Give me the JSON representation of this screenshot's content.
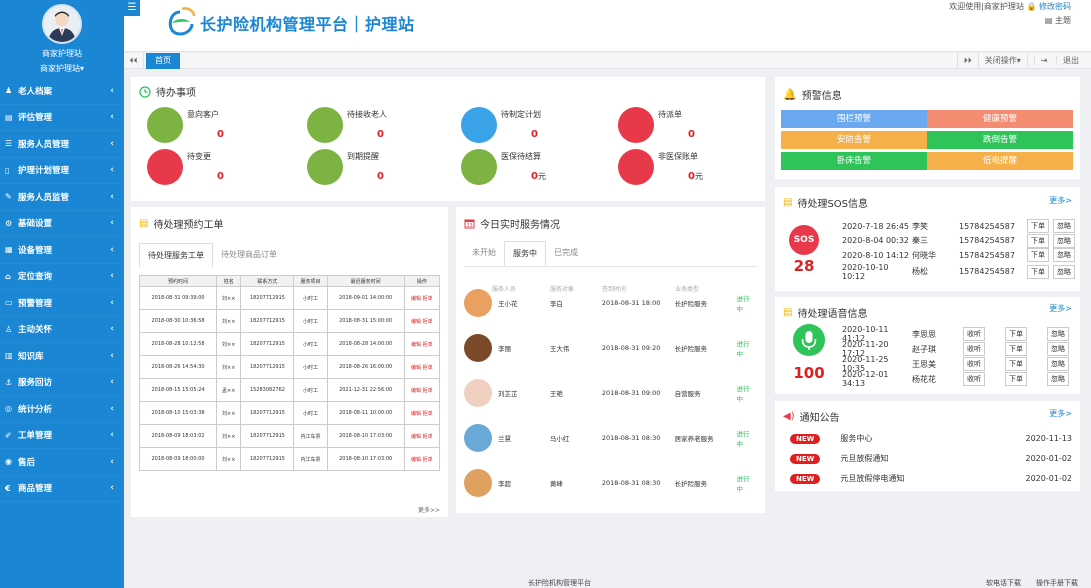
{
  "sidebar": {
    "user_name": "商家护理站",
    "user_menu": "商家护理站",
    "items": [
      {
        "icon": "user-icon",
        "glyph": "♟",
        "label": "老人档案"
      },
      {
        "icon": "file-icon",
        "glyph": "▤",
        "label": "评估管理"
      },
      {
        "icon": "list-icon",
        "glyph": "☰",
        "label": "服务人员管理"
      },
      {
        "icon": "doc-icon",
        "glyph": "▯",
        "label": "护理计划管理"
      },
      {
        "icon": "pen-icon",
        "glyph": "✎",
        "label": "服务人员监管"
      },
      {
        "icon": "gear-icon",
        "glyph": "⚙",
        "label": "基础设置"
      },
      {
        "icon": "table-icon",
        "glyph": "▦",
        "label": "设备管理"
      },
      {
        "icon": "bank-icon",
        "glyph": "⌂",
        "label": "定位查询"
      },
      {
        "icon": "monitor-icon",
        "glyph": "▭",
        "label": "预警管理"
      },
      {
        "icon": "person-icon",
        "glyph": "♙",
        "label": "主动关怀"
      },
      {
        "icon": "grid-icon",
        "glyph": "▥",
        "label": "知识库"
      },
      {
        "icon": "anchor-icon",
        "glyph": "⚓",
        "label": "服务回访"
      },
      {
        "icon": "chart-icon",
        "glyph": "◎",
        "label": "统计分析"
      },
      {
        "icon": "wrench-icon",
        "glyph": "✐",
        "label": "工单管理"
      },
      {
        "icon": "circle-icon",
        "glyph": "◉",
        "label": "售后"
      },
      {
        "icon": "euro-icon",
        "glyph": "€",
        "label": "商品管理"
      }
    ]
  },
  "header": {
    "brand": "长护险机构管理平台｜护理站",
    "welcome": "欢迎使用|商家护理站",
    "change_pwd": "修改密码",
    "theme": "主题"
  },
  "tabs": {
    "home": "首页",
    "close_ops": "关闭操作▾",
    "logout": "退出"
  },
  "todo": {
    "title": "待办事项",
    "items": [
      {
        "label": "意向客户",
        "count": "0",
        "unit": "",
        "color": "#7cb342",
        "icon": "book-icon"
      },
      {
        "label": "待接收老人",
        "count": "0",
        "unit": "",
        "color": "#7cb342",
        "icon": "elder-icon"
      },
      {
        "label": "待制定计划",
        "count": "0",
        "unit": "",
        "color": "#3aa3e8",
        "icon": "printer-icon"
      },
      {
        "label": "待派单",
        "count": "0",
        "unit": "",
        "color": "#e8394a",
        "icon": "calendar-icon"
      },
      {
        "label": "待变更",
        "count": "0",
        "unit": "",
        "color": "#e8394a",
        "icon": "news-icon"
      },
      {
        "label": "到期提醒",
        "count": "0",
        "unit": "",
        "color": "#7cb342",
        "icon": "alarm-icon"
      },
      {
        "label": "医保待结算",
        "count": "0",
        "unit": "元",
        "color": "#7cb342",
        "icon": "ticket-icon"
      },
      {
        "label": "非医保账单",
        "count": "0",
        "unit": "元",
        "color": "#e8394a",
        "icon": "register-icon"
      }
    ]
  },
  "workorder": {
    "title": "待处理预约工单",
    "tabs": [
      "待处理服务工单",
      "待处理商品订单"
    ],
    "columns": [
      "预约时间",
      "姓名",
      "联系方式",
      "服务项目",
      "最迟服务时间",
      "操作"
    ],
    "rows": [
      {
        "time": "2018-08-31 09:39:00",
        "name": "刘××",
        "phone": "18207712915",
        "service": "小时工",
        "deadline": "2018-09-01 14:00:00",
        "op": "编辑 拒单"
      },
      {
        "time": "2018-08-30 10:36:58",
        "name": "刘××",
        "phone": "18207712915",
        "service": "小时工",
        "deadline": "2018-08-31 15:00:00",
        "op": "编辑 拒单"
      },
      {
        "time": "2018-08-28 10:12:58",
        "name": "刘××",
        "phone": "18207712915",
        "service": "小时工",
        "deadline": "2018-08-28 14:00:00",
        "op": "编辑 拒单"
      },
      {
        "time": "2018-08-26 14:54:30",
        "name": "刘××",
        "phone": "18207712915",
        "service": "小时工",
        "deadline": "2018-08-26 16:00:00",
        "op": "编辑 拒单"
      },
      {
        "time": "2018-08-15 15:05:24",
        "name": "孟××",
        "phone": "15283082762",
        "service": "小时工",
        "deadline": "2021-12-31 22:56:00",
        "op": "编辑 拒单"
      },
      {
        "time": "2018-08-10 15:03:38",
        "name": "刘××",
        "phone": "18207712915",
        "service": "小时工",
        "deadline": "2018-08-11 10:00:00",
        "op": "编辑 拒单"
      },
      {
        "time": "2018-08-09 18:03:02",
        "name": "刘××",
        "phone": "18207712915",
        "service": "内江车票",
        "deadline": "2018-08-10 17:03:00",
        "op": "编辑 拒单"
      },
      {
        "time": "2018-08-09 18:00:00",
        "name": "刘××",
        "phone": "18207712915",
        "service": "内江车票",
        "deadline": "2018-08-10 17:03:00",
        "op": "编辑 拒单"
      }
    ],
    "more": "更多>>"
  },
  "service": {
    "title": "今日实时服务情况",
    "tabs": [
      "未开始",
      "服务中",
      "已完成"
    ],
    "columns": [
      "服务人员",
      "服务对象",
      "签到时间",
      "业务类型"
    ],
    "rows": [
      {
        "staff": "王小花",
        "target": "李白",
        "time": "2018-08-31 18:00",
        "type": "长护险服务",
        "status": "进行中",
        "color": "#e9a060"
      },
      {
        "staff": "李丽",
        "target": "王大伟",
        "time": "2018-08-31 09:20",
        "type": "长护险服务",
        "status": "进行中",
        "color": "#7a4a2a"
      },
      {
        "staff": "刘芷芷",
        "target": "王艳",
        "time": "2018-08-31 09:00",
        "type": "自营服务",
        "status": "进行中",
        "color": "#f0d0c0"
      },
      {
        "staff": "兰慧",
        "target": "马小红",
        "time": "2018-08-31 08:30",
        "type": "居家养老服务",
        "status": "进行中",
        "color": "#6aa8d8"
      },
      {
        "staff": "李超",
        "target": "黄峰",
        "time": "2018-08-31 08:30",
        "type": "长护险服务",
        "status": "进行中",
        "color": "#e0a060"
      }
    ]
  },
  "warning": {
    "title": "预警信息",
    "items": [
      {
        "label": "围栏预警",
        "color": "#6aa8f0"
      },
      {
        "label": "健康预警",
        "color": "#f48c72"
      },
      {
        "label": "安防告警",
        "color": "#f5b04a"
      },
      {
        "label": "跌倒告警",
        "color": "#2ec45a"
      },
      {
        "label": "卧床告警",
        "color": "#2ec45a"
      },
      {
        "label": "低电提醒",
        "color": "#f5b04a"
      }
    ]
  },
  "sos": {
    "title": "待处理SOS信息",
    "more": "更多>",
    "badge": "SOS",
    "count": "28",
    "rows": [
      {
        "time": "2020-7-18 26:45",
        "name": "李笑",
        "phone": "15784254587",
        "b1": "下单",
        "b2": "忽略"
      },
      {
        "time": "2020-8-04 00:32",
        "name": "秦三",
        "phone": "15784254587",
        "b1": "下单",
        "b2": "忽略"
      },
      {
        "time": "2020-8-10 14:12",
        "name": "何晓华",
        "phone": "15784254587",
        "b1": "下单",
        "b2": "忽略"
      },
      {
        "time": "2020-10-10 10:12",
        "name": "杨松",
        "phone": "15784254587",
        "b1": "下单",
        "b2": "忽略"
      }
    ]
  },
  "voice": {
    "title": "待处理语音信息",
    "more": "更多>",
    "count": "100",
    "rows": [
      {
        "time": "2020-10-11 41:12",
        "name": "李思思",
        "b0": "收听",
        "b1": "下单",
        "b2": "忽略"
      },
      {
        "time": "2020-11-20 17:12",
        "name": "赵子琪",
        "b0": "收听",
        "b1": "下单",
        "b2": "忽略"
      },
      {
        "time": "2020-11-25 10:35",
        "name": "王思美",
        "b0": "收听",
        "b1": "下单",
        "b2": "忽略"
      },
      {
        "time": "2020-12-01 34:13",
        "name": "杨花花",
        "b0": "收听",
        "b1": "下单",
        "b2": "忽略"
      }
    ]
  },
  "notice": {
    "title": "通知公告",
    "more": "更多>",
    "badge": "NEW",
    "rows": [
      {
        "title": "服务中心",
        "date": "2020-11-13"
      },
      {
        "title": "元旦放假通知",
        "date": "2020-01-02"
      },
      {
        "title": "元旦放假停电通知",
        "date": "2020-01-02"
      }
    ]
  },
  "footer": {
    "center": "长护险机构管理平台",
    "download": "软电话下载",
    "manual": "操作手册下载"
  }
}
